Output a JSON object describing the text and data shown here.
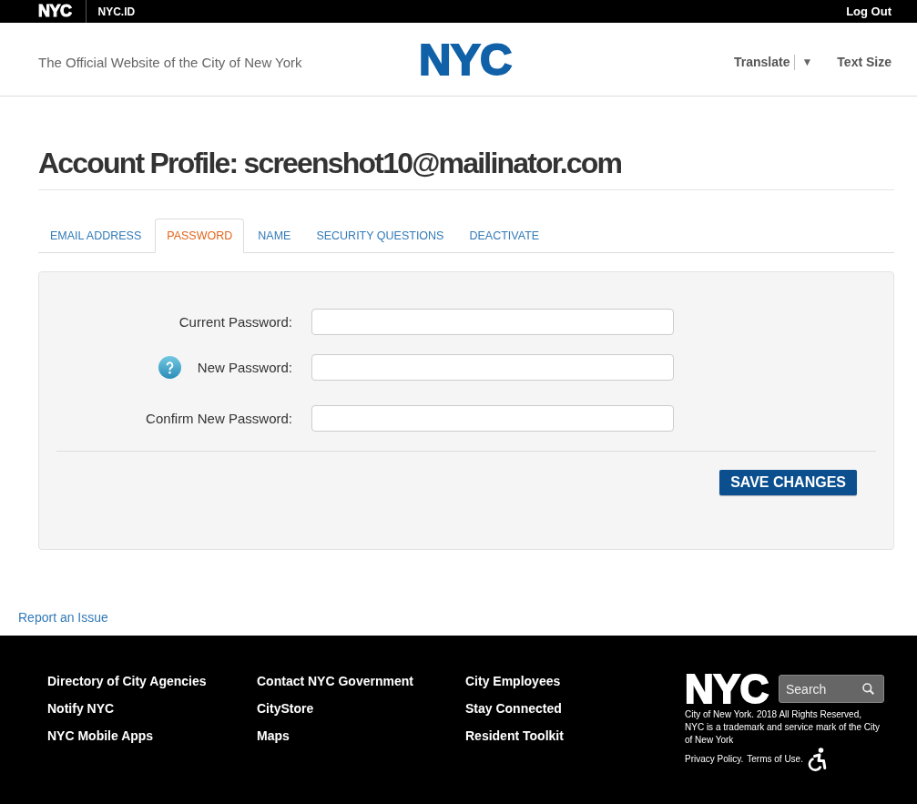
{
  "top_bar": {
    "logo": "NYC",
    "app_name": "NYC.ID",
    "log_out": "Log Out"
  },
  "header": {
    "tagline": "The Official Website of the City of New York",
    "logo": "NYC",
    "translate": "Translate",
    "translate_caret": "▼",
    "text_size": "Text Size"
  },
  "page_title": "Account Profile: screenshot10@mailinator.com",
  "tabs": [
    {
      "label": "EMAIL ADDRESS",
      "selected": false
    },
    {
      "label": "PASSWORD",
      "selected": true
    },
    {
      "label": "NAME",
      "selected": false
    },
    {
      "label": "SECURITY QUESTIONS",
      "selected": false
    },
    {
      "label": "DEACTIVATE",
      "selected": false
    }
  ],
  "form": {
    "fields": [
      {
        "label": "Current Password:",
        "help": false
      },
      {
        "label": "New Password:",
        "help": true
      },
      {
        "label": "Confirm New Password:",
        "help": false
      }
    ],
    "submit": "SAVE CHANGES"
  },
  "report_link": "Report an Issue",
  "footer": {
    "columns": [
      {
        "links": [
          "Directory of City Agencies",
          "Notify NYC",
          "NYC Mobile Apps"
        ]
      },
      {
        "links": [
          "Contact NYC Government",
          "CityStore",
          "Maps"
        ]
      },
      {
        "links": [
          "City Employees",
          "Stay Connected",
          "Resident Toolkit"
        ]
      }
    ],
    "logo": "NYC",
    "search": {
      "placeholder": "Search"
    },
    "copyright": "City of New York. 2018 All Rights Reserved, NYC is a trademark and service mark of the City of New York",
    "legal_links": [
      "Privacy Policy.",
      "Terms of Use."
    ]
  }
}
